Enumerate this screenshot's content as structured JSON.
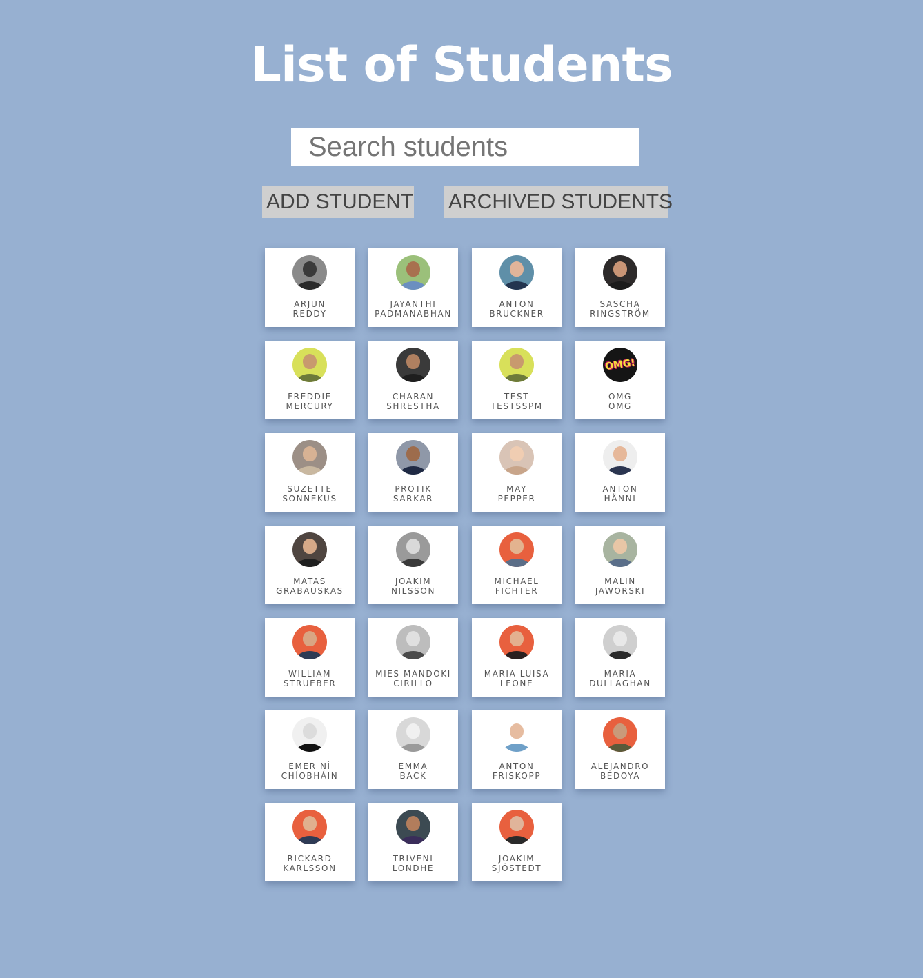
{
  "header": {
    "title": "List of Students"
  },
  "search": {
    "placeholder": "Search students",
    "value": ""
  },
  "actions": {
    "add_label": "ADD STUDENT",
    "archived_label": "ARCHIVED STUDENTS"
  },
  "students": [
    {
      "first": "ARJUN",
      "last": "REDDY",
      "avatar_bg": "#8a8a8a",
      "skin": "#3a3a3a",
      "clothes": "#2a2a2a"
    },
    {
      "first": "JAYANTHI",
      "last": "PADMANABHAN",
      "avatar_bg": "#9bc07a",
      "skin": "#a8714f",
      "clothes": "#6b8fc0"
    },
    {
      "first": "ANTON",
      "last": "BRUCKNER",
      "avatar_bg": "#5f8fa8",
      "skin": "#e0b49a",
      "clothes": "#23344f"
    },
    {
      "first": "SASCHA",
      "last": "RINGSTRÖM",
      "avatar_bg": "#2d2a2a",
      "skin": "#c99576",
      "clothes": "#1b1b1b"
    },
    {
      "first": "FREDDIE",
      "last": "MERCURY",
      "avatar_bg": "#d8e05a",
      "skin": "#c89a6e",
      "clothes": "#6d7a3a"
    },
    {
      "first": "CHARAN",
      "last": "SHRESTHA",
      "avatar_bg": "#3a3a3a",
      "skin": "#b08060",
      "clothes": "#1e1e1e"
    },
    {
      "first": "TEST",
      "last": "TESTSSPM",
      "avatar_bg": "#d8e05a",
      "skin": "#c89a6e",
      "clothes": "#6d7a3a"
    },
    {
      "first": "OMG",
      "last": "OMG",
      "avatar_bg": "#151515",
      "skin": "#151515",
      "clothes": "#151515",
      "badge": "OMG!"
    },
    {
      "first": "SUZETTE",
      "last": "SONNEKUS",
      "avatar_bg": "#9c8f86",
      "skin": "#d7b294",
      "clothes": "#c9b8a0"
    },
    {
      "first": "PROTIK",
      "last": "SARKAR",
      "avatar_bg": "#8f98a8",
      "skin": "#9d6c4c",
      "clothes": "#1f2a44"
    },
    {
      "first": "MAY",
      "last": "PEPPER",
      "avatar_bg": "#d9c4b6",
      "skin": "#f0cdb2",
      "clothes": "#c8a58a"
    },
    {
      "first": "ANTON",
      "last": "HÄNNI",
      "avatar_bg": "#eeeeee",
      "skin": "#e6b89a",
      "clothes": "#2b3550"
    },
    {
      "first": "MATAS",
      "last": "GRABAUSKAS",
      "avatar_bg": "#4f4540",
      "skin": "#d6a988",
      "clothes": "#1f1f1f"
    },
    {
      "first": "JOAKIM",
      "last": "NILSSON",
      "avatar_bg": "#9a9a9a",
      "skin": "#d9d9d9",
      "clothes": "#3a3a3a"
    },
    {
      "first": "MICHAEL",
      "last": "FICHTER",
      "avatar_bg": "#e8603e",
      "skin": "#e3b38f",
      "clothes": "#5b6e88"
    },
    {
      "first": "MALIN",
      "last": "JAWORSKI",
      "avatar_bg": "#a8b4a0",
      "skin": "#e8c6a6",
      "clothes": "#5b6f8a"
    },
    {
      "first": "WILLIAM",
      "last": "STRUEBER",
      "avatar_bg": "#e8603e",
      "skin": "#d9a583",
      "clothes": "#2e3b55"
    },
    {
      "first": "MIES MANDOKI",
      "last": "CIRILLO",
      "avatar_bg": "#bdbdbd",
      "skin": "#e0e0e0",
      "clothes": "#4a4a4a"
    },
    {
      "first": "MARIA LUISA",
      "last": "LEONE",
      "avatar_bg": "#e8603e",
      "skin": "#e3b08f",
      "clothes": "#2a2020"
    },
    {
      "first": "MARIA",
      "last": "DULLAGHAN",
      "avatar_bg": "#cfcfcf",
      "skin": "#e8e8e8",
      "clothes": "#2a2a2a"
    },
    {
      "first": "EMER NÍ",
      "last": "CHÍOBHÁIN",
      "avatar_bg": "#f0f0f0",
      "skin": "#dcdcdc",
      "clothes": "#111111"
    },
    {
      "first": "EMMA",
      "last": "BACK",
      "avatar_bg": "#d8d8d8",
      "skin": "#f0f0f0",
      "clothes": "#9a9a9a"
    },
    {
      "first": "ANTON",
      "last": "FRISKOPP",
      "avatar_bg": "#ffffff",
      "skin": "#e6bca0",
      "clothes": "#6fa0c8"
    },
    {
      "first": "ALEJANDRO",
      "last": "BEDOYA",
      "avatar_bg": "#e8603e",
      "skin": "#c99a7a",
      "clothes": "#5a5a3a"
    },
    {
      "first": "RICKARD",
      "last": "KARLSSON",
      "avatar_bg": "#e8603e",
      "skin": "#e0b08e",
      "clothes": "#2e3b55"
    },
    {
      "first": "TRIVENI",
      "last": "LONDHE",
      "avatar_bg": "#3c4a52",
      "skin": "#b27d5c",
      "clothes": "#3a2d5a"
    },
    {
      "first": "JOAKIM",
      "last": "SJÖSTEDT",
      "avatar_bg": "#e8603e",
      "skin": "#e0b49a",
      "clothes": "#2a2a2a"
    }
  ]
}
